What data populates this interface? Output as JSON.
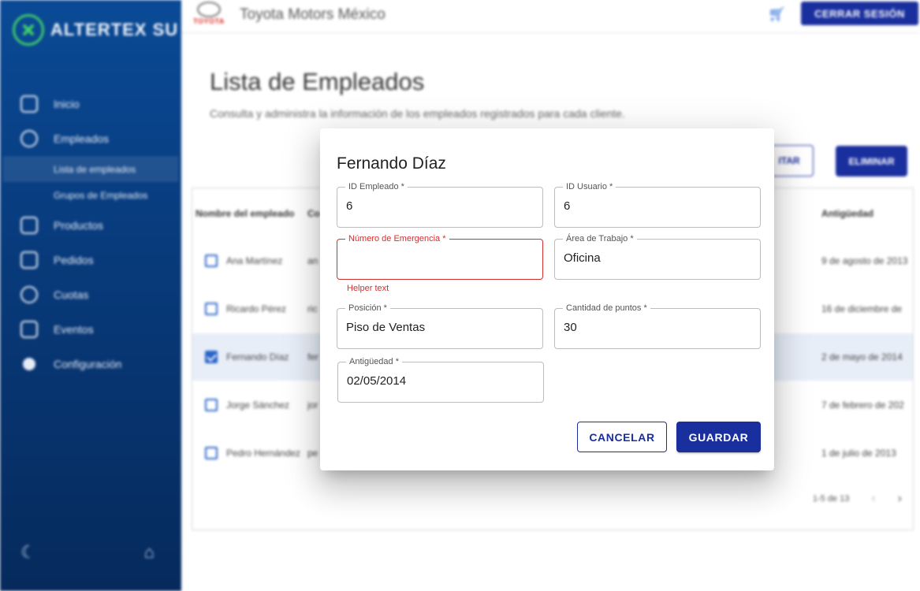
{
  "sidebar": {
    "brand": "ALTERTEX SU",
    "nav": [
      {
        "label": "Inicio",
        "icon": "home-icon"
      },
      {
        "label": "Empleados",
        "icon": "people-icon"
      },
      {
        "label": "Productos",
        "icon": "box-icon"
      },
      {
        "label": "Pedidos",
        "icon": "inbox-icon"
      },
      {
        "label": "Cuotas",
        "icon": "coins-icon"
      },
      {
        "label": "Eventos",
        "icon": "calendar-icon"
      },
      {
        "label": "Configuración",
        "icon": "gear-icon"
      }
    ],
    "sub": [
      "Lista de empleados",
      "Grupos de Empleados"
    ],
    "footer_icons": [
      "moon-icon",
      "home-icon"
    ]
  },
  "header": {
    "brand_logo_text": "TOYOTA",
    "company": "Toyota Motors México",
    "logout_label": "CERRAR SESIÓN",
    "cart_icon": "cart-icon"
  },
  "page": {
    "title": "Lista de Empleados",
    "description": "Consulta y administra la información de los empleados registrados para cada cliente.",
    "edit_label": "ITAR",
    "delete_label": "ELIMINAR"
  },
  "table": {
    "headers": [
      "Nombre del empleado",
      "Co",
      "Antigüedad"
    ],
    "rows": [
      {
        "name": "Ana Martínez",
        "user": "an",
        "date": "9 de agosto de 2013",
        "selected": false
      },
      {
        "name": "Ricardo Pérez",
        "user": "ric",
        "date": "16 de diciembre de",
        "selected": false
      },
      {
        "name": "Fernando Díaz",
        "user": "fer",
        "date": "2 de mayo de 2014",
        "selected": true
      },
      {
        "name": "Jorge Sánchez",
        "user": "jor",
        "date": "7 de febrero de 202",
        "selected": false
      },
      {
        "name": "Pedro Hernández",
        "user": "pe",
        "date": "1 de julio de 2013",
        "selected": false
      }
    ],
    "pagination": "1-5 de 13"
  },
  "dialog": {
    "title": "Fernando Díaz",
    "fields": {
      "employee_id": {
        "label": "ID Empleado *",
        "value": "6"
      },
      "user_id": {
        "label": "ID Usuario *",
        "value": "6"
      },
      "emergency": {
        "label": "Número de Emergencia *",
        "value": ""
      },
      "area": {
        "label": "Área de Trabajo *",
        "value": "Oficina"
      },
      "position": {
        "label": "Posición *",
        "value": "Piso de Ventas"
      },
      "points": {
        "label": "Cantidad de puntos *",
        "value": "30"
      },
      "seniority": {
        "label": "Antigüedad *",
        "value": "02/05/2014"
      }
    },
    "helper_text": "Helper text",
    "cancel_label": "CANCELAR",
    "save_label": "GUARDAR"
  },
  "colors": {
    "primary": "#1a2f9e",
    "error": "#d32f2f",
    "sidebar_top": "#0a4a96",
    "sidebar_bottom": "#062a5c",
    "checkbox": "#2a64c8"
  }
}
